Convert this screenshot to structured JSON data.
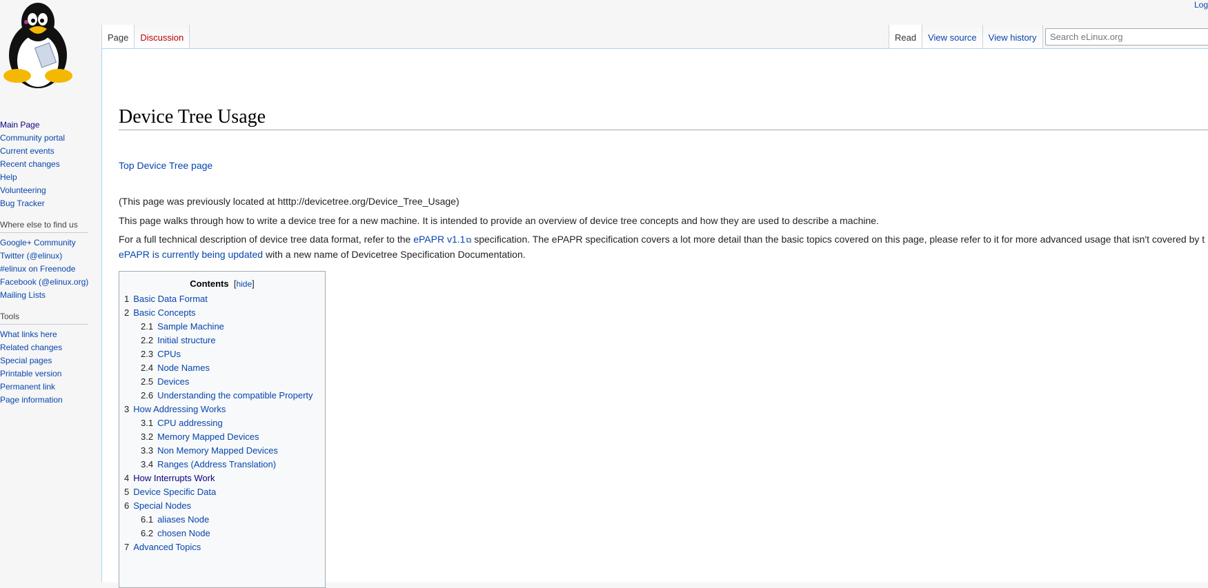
{
  "personal": {
    "login": "Log"
  },
  "tabs_left": [
    {
      "label": "Page",
      "state": "selected"
    },
    {
      "label": "Discussion",
      "state": "new"
    }
  ],
  "tabs_right": [
    {
      "label": "Read",
      "state": "selected"
    },
    {
      "label": "View source",
      "state": "normal"
    },
    {
      "label": "View history",
      "state": "normal"
    }
  ],
  "search": {
    "placeholder": "Search eLinux.org",
    "value": ""
  },
  "sidebar": {
    "nav": [
      "Main Page",
      "Community portal",
      "Current events",
      "Recent changes",
      "Help",
      "Volunteering",
      "Bug Tracker"
    ],
    "find_us": {
      "heading": "Where else to find us",
      "items": [
        "Google+ Community",
        "Twitter (@elinux)",
        "#elinux on Freenode",
        "Facebook (@elinux.org)",
        "Mailing Lists"
      ]
    },
    "tools": {
      "heading": "Tools",
      "items": [
        "What links here",
        "Related changes",
        "Special pages",
        "Printable version",
        "Permanent link",
        "Page information"
      ]
    }
  },
  "page": {
    "title": "Device Tree Usage",
    "top_link": "Top Device Tree page",
    "previously": "(This page was previously located at htttp://devicetree.org/Device_Tree_Usage)",
    "intro": "This page walks through how to write a device tree for a new machine. It is intended to provide an overview of device tree concepts and how they are used to describe a machine.",
    "full_desc_pre": "For a full technical description of device tree data format, refer to the ",
    "epapr_link": "ePAPR v1.1",
    "full_desc_post": " specification. The ePAPR specification covers a lot more detail than the basic topics covered on this page, please refer to it for more advanced usage that isn't covered by t",
    "updated_link": "ePAPR is currently being updated",
    "updated_post": " with a new name of Devicetree Specification Documentation."
  },
  "toc": {
    "title": "Contents",
    "hide_label": "hide",
    "items": [
      {
        "num": "1",
        "label": "Basic Data Format",
        "level": 1
      },
      {
        "num": "2",
        "label": "Basic Concepts",
        "level": 1
      },
      {
        "num": "2.1",
        "label": "Sample Machine",
        "level": 2
      },
      {
        "num": "2.2",
        "label": "Initial structure",
        "level": 2
      },
      {
        "num": "2.3",
        "label": "CPUs",
        "level": 2
      },
      {
        "num": "2.4",
        "label": "Node Names",
        "level": 2
      },
      {
        "num": "2.5",
        "label": "Devices",
        "level": 2
      },
      {
        "num": "2.6",
        "label": "Understanding the compatible Property",
        "level": 2
      },
      {
        "num": "3",
        "label": "How Addressing Works",
        "level": 1
      },
      {
        "num": "3.1",
        "label": "CPU addressing",
        "level": 2
      },
      {
        "num": "3.2",
        "label": "Memory Mapped Devices",
        "level": 2
      },
      {
        "num": "3.3",
        "label": "Non Memory Mapped Devices",
        "level": 2
      },
      {
        "num": "3.4",
        "label": "Ranges (Address Translation)",
        "level": 2
      },
      {
        "num": "4",
        "label": "How Interrupts Work",
        "level": 1,
        "visited": true
      },
      {
        "num": "5",
        "label": "Device Specific Data",
        "level": 1
      },
      {
        "num": "6",
        "label": "Special Nodes",
        "level": 1
      },
      {
        "num": "6.1",
        "label": "aliases Node",
        "level": 2
      },
      {
        "num": "6.2",
        "label": "chosen Node",
        "level": 2
      },
      {
        "num": "7",
        "label": "Advanced Topics",
        "level": 1
      }
    ]
  },
  "colors": {
    "link": "#0645ad",
    "visited": "#0b0080",
    "new_link": "#ba0000",
    "border": "#a7d7f9"
  },
  "logo": {
    "icon": "tux-penguin-icon"
  }
}
